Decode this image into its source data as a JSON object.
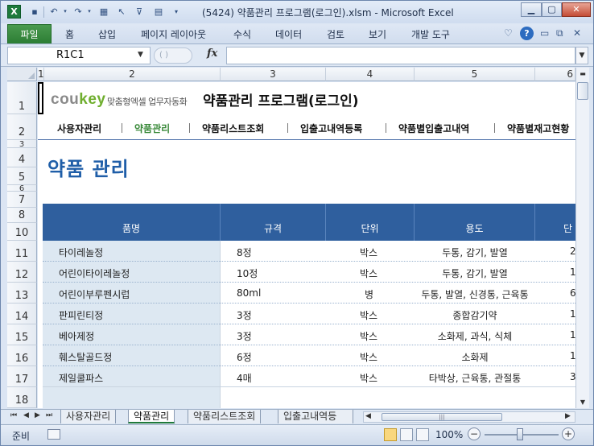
{
  "window": {
    "title": "(5424) 약품관리 프로그램(로그인).xlsm  -  Microsoft Excel",
    "app_icon": "X"
  },
  "ribbon": {
    "file_tab": "파일",
    "tabs": [
      "홈",
      "삽입",
      "페이지 레이아웃",
      "수식",
      "데이터",
      "검토",
      "보기",
      "개발 도구"
    ]
  },
  "formula_bar": {
    "name_box": "R1C1",
    "fx_label": "fx",
    "formula": ""
  },
  "grid": {
    "columns": [
      "1",
      "2",
      "3",
      "4",
      "5",
      "6"
    ],
    "rows": [
      "1",
      "2",
      "3",
      "4",
      "5",
      "6",
      "7",
      "8",
      "10",
      "11",
      "12",
      "13",
      "14",
      "15",
      "16",
      "17",
      "18"
    ]
  },
  "header": {
    "logo_main": "cou",
    "logo_accent": "key",
    "logo_sub": "맞춤형엑셀 업무자동화",
    "app_title": "약품관리 프로그램(로그인)"
  },
  "nav": {
    "items": [
      "사용자관리",
      "약품관리",
      "약품리스트조회",
      "입출고내역등록",
      "약품별입출고내역",
      "약품별재고현황"
    ],
    "active": "약품관리"
  },
  "page_title": "약품 관리",
  "table": {
    "headers": [
      "품명",
      "규격",
      "단위",
      "용도",
      "단"
    ],
    "rows": [
      {
        "name": "타이레놀정",
        "spec": "8정",
        "unit": "박스",
        "use": "두통, 감기, 발열",
        "extra": "2"
      },
      {
        "name": "어린이타이레놀정",
        "spec": "10정",
        "unit": "박스",
        "use": "두통, 감기, 발열",
        "extra": "1"
      },
      {
        "name": "어린이부루펜시럽",
        "spec": "80ml",
        "unit": "병",
        "use": "두통, 발열, 신경통, 근육통",
        "extra": "6"
      },
      {
        "name": "판피린티정",
        "spec": "3정",
        "unit": "박스",
        "use": "종합감기약",
        "extra": "1"
      },
      {
        "name": "베아제정",
        "spec": "3정",
        "unit": "박스",
        "use": "소화제, 과식, 식체",
        "extra": "1"
      },
      {
        "name": "훼스탈골드정",
        "spec": "6정",
        "unit": "박스",
        "use": "소화제",
        "extra": "1"
      },
      {
        "name": "제일쿨파스",
        "spec": "4매",
        "unit": "박스",
        "use": "타박상, 근육통, 관절통",
        "extra": "3"
      }
    ]
  },
  "sheet_tabs": {
    "tabs": [
      "사용자관리",
      "약품관리",
      "약품리스트조회",
      "입출고내역등"
    ],
    "active": "약품관리"
  },
  "status": {
    "ready": "준비",
    "zoom": "100%"
  }
}
